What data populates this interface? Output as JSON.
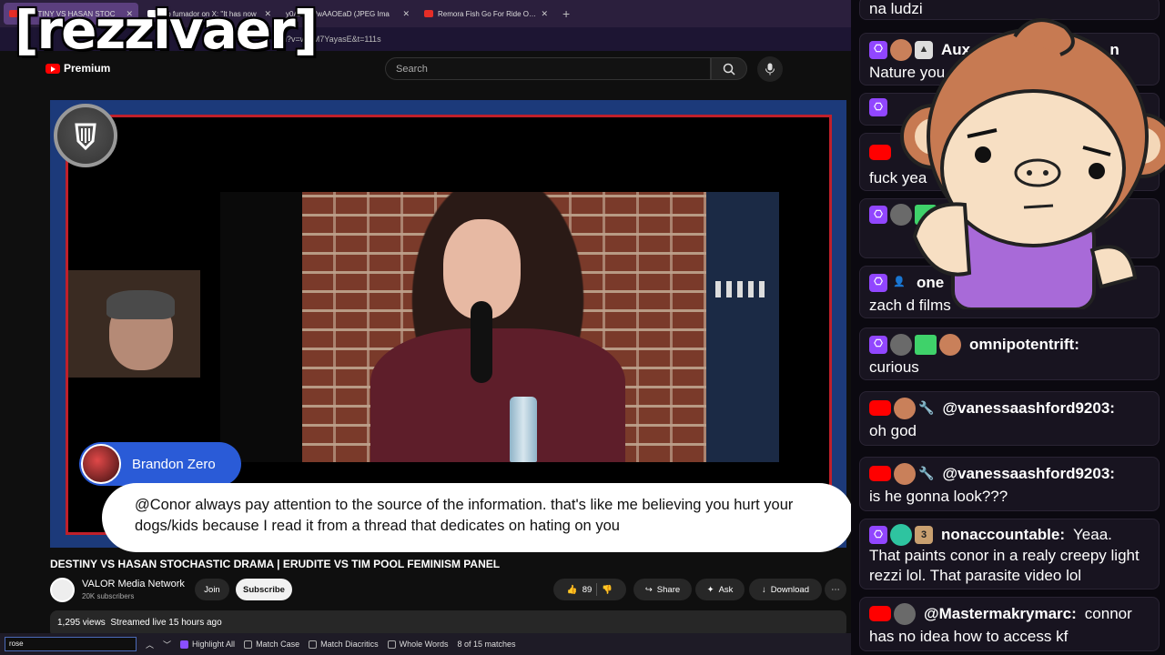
{
  "browser": {
    "tabs": [
      {
        "title": "DESTINY VS HASAN STOC",
        "active": true
      },
      {
        "title": "sto fumador on X: \"It has now",
        "active": false
      },
      {
        "title": "y0Asu2WwAAOEaD (JPEG Ima",
        "active": false
      },
      {
        "title": "Remora Fish Go For Ride On Wi",
        "active": false
      }
    ],
    "url": "h?v=w7IM7YayasE&t=111s"
  },
  "overlay": {
    "streamer": "[rezzivaer]",
    "premium": "Premium"
  },
  "header": {
    "search_placeholder": "Search"
  },
  "video": {
    "chatter_name": "Brandon Zero",
    "chatter_message": "@Conor always pay attention to the source of the information. that's like me believing you hurt your dogs/kids because I read it from a thread that dedicates on hating on you",
    "title": "DESTINY VS HASAN STOCHASTIC DRAMA | ERUDITE VS TIM POOL FEMINISM PANEL",
    "channel": "VALOR Media Network",
    "subscribers": "20K subscribers",
    "join": "Join",
    "subscribe": "Subscribe",
    "likes": "89",
    "share": "Share",
    "ask": "Ask",
    "download": "Download",
    "views": "1,295 views",
    "streamed": "Streamed live 15 hours ago"
  },
  "find": {
    "query": "rose",
    "highlight_all": "Highlight All",
    "match_case": "Match Case",
    "match_diacritics": "Match Diacritics",
    "whole_words": "Whole Words",
    "status": "8 of 15 matches"
  },
  "chat": {
    "m0": {
      "text": "na ludzi"
    },
    "m1": {
      "user": "Aux_Pe",
      "tail": "n",
      "text": "Nature you scar"
    },
    "m3": {
      "text": "fuck yea"
    },
    "m5": {
      "user": "one",
      "text": "zach d films"
    },
    "m6": {
      "user": "omnipotentrift:",
      "text": "curious"
    },
    "m7": {
      "user": "@vanessaashford9203:",
      "text": "oh god"
    },
    "m8": {
      "user": "@vanessaashford9203:",
      "text": "is he gonna look???"
    },
    "m9": {
      "user": "nonaccountable:",
      "text": "Yeaa.",
      "text2": "That paints conor in a realy creepy light rezzi lol. That parasite video lol",
      "badge": "3"
    },
    "m10": {
      "user": "@Mastermakrymarc:",
      "text": "connor",
      "text2": "has no idea how to access kf"
    }
  }
}
